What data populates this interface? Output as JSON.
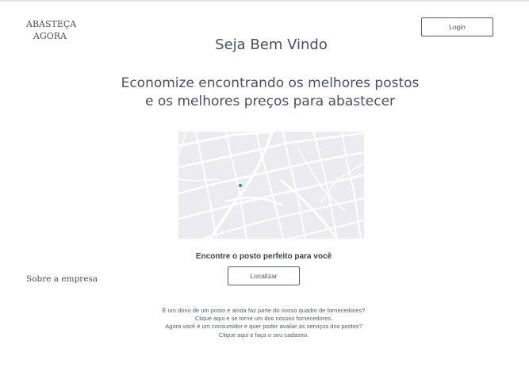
{
  "header": {
    "brand_line1": "ABASTEÇA",
    "brand_line2": "AGORA",
    "login_label": "Login"
  },
  "hero": {
    "welcome": "Seja Bem Vindo",
    "tagline_line1": "Economize encontrando os melhores postos",
    "tagline_line2": "e os melhores preços para abastecer"
  },
  "map": {
    "icon": "map-icon",
    "location_marker": "location-dot-icon",
    "background_color": "#ececf0",
    "marker_color": "#2a8fd6"
  },
  "finder": {
    "prompt": "Encontre o posto perfeito para você",
    "locate_label": "Localizar"
  },
  "sidebar": {
    "about_link": "Sobre a empresa"
  },
  "footer": {
    "line1": "É um dono de um posto e ainda faz parte do nosso quadro de fornecedores?",
    "line2": "Clique aqui e se torne um dos nossos fornecedores.",
    "line3": "Agora você é um consumidor e quer poder avaliar os serviços dos postos?",
    "line4": "Clique aqui e faça o seu cadastro."
  }
}
